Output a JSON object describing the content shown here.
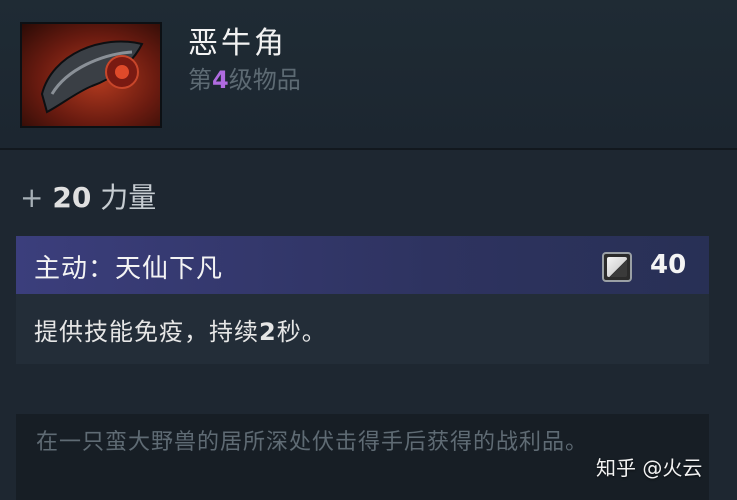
{
  "item": {
    "name": "恶牛角",
    "tier_prefix": "第",
    "tier_number": "4",
    "tier_suffix": "级物品",
    "tier_color": "#b06be0"
  },
  "stats": [
    {
      "prefix": "+",
      "value": "20",
      "name": "力量"
    }
  ],
  "active": {
    "title": "主动：天仙下凡",
    "mana_icon": "mana-cost-icon",
    "cooldown": "40",
    "bar_color": "#3b3e7c",
    "desc_before": "提供技能免疫，持续",
    "desc_value": "2",
    "desc_after": "秒。"
  },
  "lore": "在一只蛮大野兽的居所深处伏击得手后获得的战利品。",
  "watermark": "知乎 @火云"
}
